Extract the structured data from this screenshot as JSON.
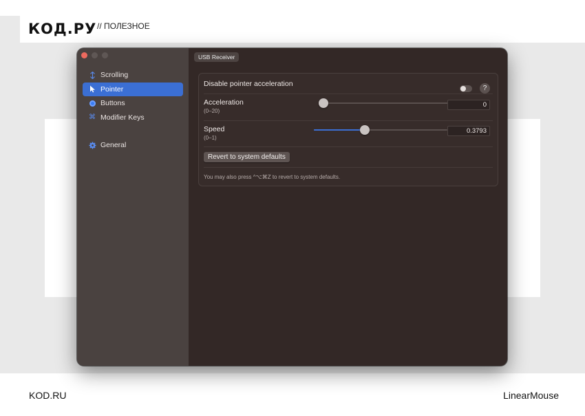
{
  "brand": {
    "logo": "КОД.РУ",
    "tag": "// ПОЛЕЗНОЕ"
  },
  "footer": {
    "left": "KOD.RU",
    "right": "LinearMouse"
  },
  "window": {
    "device": "USB Receiver",
    "sidebar": {
      "items": [
        {
          "label": "Scrolling",
          "icon": "scroll-arrows-icon",
          "active": false
        },
        {
          "label": "Pointer",
          "icon": "pointer-arrow-icon",
          "active": true
        },
        {
          "label": "Buttons",
          "icon": "circle-button-icon",
          "active": false
        },
        {
          "label": "Modifier Keys",
          "icon": "command-key-icon",
          "active": false
        },
        {
          "label": "General",
          "icon": "gear-icon",
          "active": false
        }
      ]
    },
    "pointer": {
      "disable_accel_label": "Disable pointer acceleration",
      "disable_accel_on": false,
      "help": "?",
      "acceleration": {
        "label": "Acceleration",
        "range": "(0–20)",
        "value": "0",
        "fraction": 0.0
      },
      "speed": {
        "label": "Speed",
        "range": "(0–1)",
        "value": "0.3793",
        "fraction": 0.3793
      },
      "revert_label": "Revert to system defaults",
      "hint": "You may also press ^⌥⌘Z to revert to system defaults."
    }
  },
  "colors": {
    "accent": "#3b6fd4",
    "window_bg": "#332826",
    "sidebar_bg": "#4a4240"
  }
}
